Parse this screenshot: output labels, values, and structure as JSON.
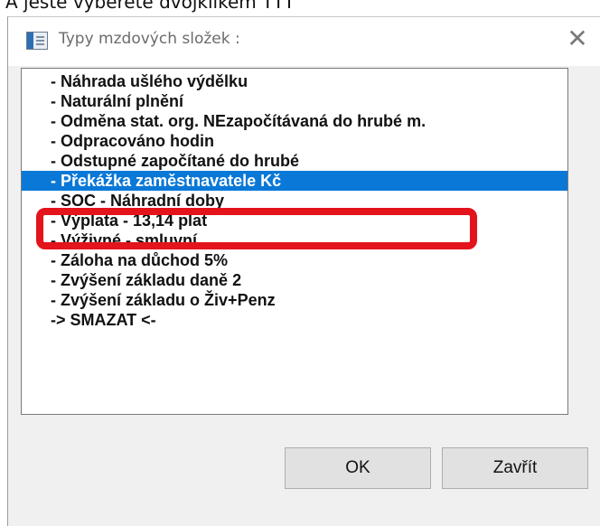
{
  "caption": "A ještě vyberete dvojklikem TTT",
  "dialog": {
    "title": "Typy mzdových složek :",
    "close_glyph": "✕",
    "items": [
      {
        "label": "- Náhrada ušlého výdělku"
      },
      {
        "label": "- Naturální plnění"
      },
      {
        "label": "- Odměna stat. org. NEzapočítávaná do hrubé m."
      },
      {
        "label": "- Odpracováno hodin"
      },
      {
        "label": "- Odstupné započítané do hrubé"
      },
      {
        "label": "- Překážka zaměstnavatele Kč",
        "selected": true
      },
      {
        "label": "- SOC - Náhradní doby"
      },
      {
        "label": "- Výplata - 13,14 plat"
      },
      {
        "label": "- Výživné - smluvní"
      },
      {
        "label": "- Záloha na důchod 5%"
      },
      {
        "label": "- Zvýšení základu daně 2"
      },
      {
        "label": "- Zvýšení základu o Živ+Penz"
      },
      {
        "label": "-> SMAZAT <-"
      }
    ],
    "ok_label": "OK",
    "close_label": "Zavřít"
  }
}
